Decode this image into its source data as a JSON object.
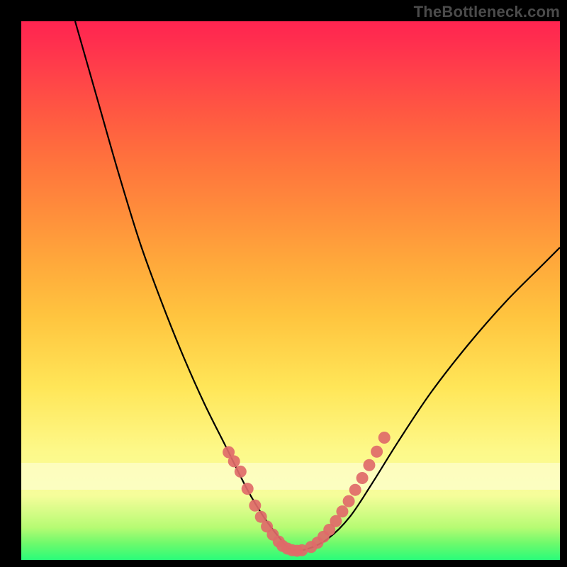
{
  "watermark": "TheBottleneck.com",
  "chart_data": {
    "type": "line",
    "title": "",
    "xlabel": "",
    "ylabel": "",
    "xlim": [
      0,
      100
    ],
    "ylim": [
      0,
      100
    ],
    "grid": false,
    "highlight_band": {
      "y0": 13,
      "y1": 18
    },
    "series": [
      {
        "name": "bottleneck-curve",
        "color": "#000000",
        "x": [
          10,
          14,
          18,
          22,
          26,
          30,
          34,
          38,
          42,
          45,
          48,
          50,
          53,
          57,
          61,
          65,
          70,
          76,
          83,
          90,
          97,
          100
        ],
        "y": [
          100,
          86,
          72,
          59,
          48,
          38,
          29,
          21,
          13,
          8,
          4,
          2,
          2,
          4,
          8,
          14,
          22,
          31,
          40,
          48,
          55,
          58
        ]
      }
    ],
    "scatter": [
      {
        "name": "left-cluster",
        "color": "#e06a69",
        "x": [
          38.5,
          39.5,
          40.7,
          42.0,
          43.4,
          44.5,
          45.6,
          46.7,
          47.8,
          48.5,
          49.4,
          50.3,
          51.2,
          52.1
        ],
        "y": [
          20.0,
          18.3,
          16.4,
          13.2,
          10.1,
          8.0,
          6.2,
          4.7,
          3.4,
          2.6,
          2.1,
          1.8,
          1.7,
          1.8
        ]
      },
      {
        "name": "right-cluster",
        "color": "#e06a69",
        "x": [
          53.8,
          55.0,
          56.1,
          57.2,
          58.4,
          59.6,
          60.8,
          62.0,
          63.3,
          64.6,
          66.0,
          67.4
        ],
        "y": [
          2.4,
          3.2,
          4.3,
          5.6,
          7.2,
          9.0,
          10.9,
          13.0,
          15.2,
          17.6,
          20.1,
          22.7
        ]
      }
    ],
    "colors": {
      "bg_frame": "#000000",
      "dot": "#e06a69",
      "curve": "#000000"
    }
  }
}
